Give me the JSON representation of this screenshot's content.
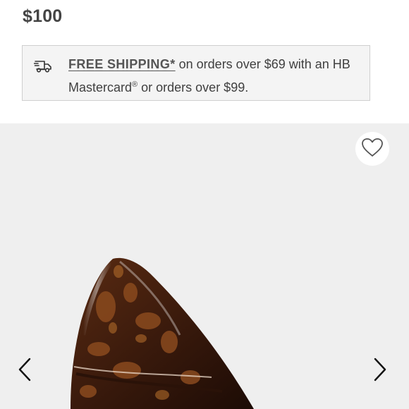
{
  "product": {
    "price": "$100",
    "image_alt": "Tortoiseshell patent leather pointed-toe pump"
  },
  "shipping_banner": {
    "icon": "truck-icon",
    "link_text": "FREE SHIPPING*",
    "message_part_1": " on orders over $69 with an HB Mastercard",
    "registered_mark": "®",
    "message_part_2": " or orders over $99."
  },
  "gallery": {
    "favorite_icon": "heart-icon",
    "prev_icon": "chevron-left-icon",
    "next_icon": "chevron-right-icon"
  },
  "colors": {
    "page_background": "#ffffff",
    "banner_background": "#f4f4f4",
    "gallery_background": "#efefef",
    "text": "#404040"
  }
}
